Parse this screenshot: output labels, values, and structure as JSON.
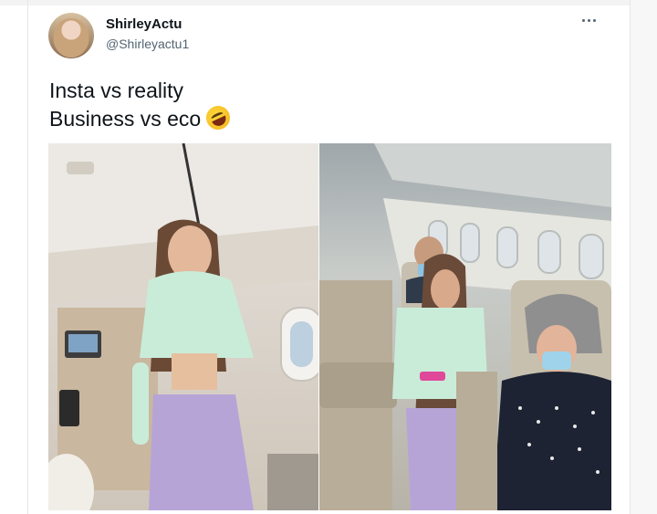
{
  "tweet": {
    "author": {
      "display_name": "ShirleyActu",
      "handle": "@Shirleyactu1"
    },
    "text_lines": [
      "Insta vs reality",
      "Business vs eco"
    ],
    "emoji": "rolling-on-the-floor-laughing",
    "media": [
      {
        "description_icon": "business-cabin-photo"
      },
      {
        "description_icon": "economy-cabin-photo"
      }
    ]
  },
  "colors": {
    "text_primary": "#0f1419",
    "text_secondary": "#536471",
    "background": "#ffffff"
  }
}
